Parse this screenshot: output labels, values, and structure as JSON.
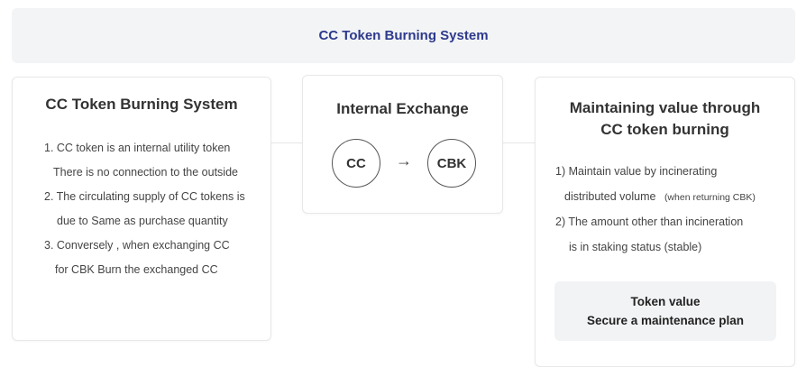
{
  "banner": {
    "title": "CC Token Burning System"
  },
  "left_card": {
    "title": "CC Token Burning System",
    "lines": [
      "1. CC token is an internal utility token",
      "There is no connection to the outside",
      "2. The circulating supply of CC tokens is",
      "due to Same as purchase quantity",
      "3. Conversely , when exchanging CC",
      "for CBK Burn the exchanged CC"
    ]
  },
  "mid_card": {
    "title": "Internal Exchange",
    "from": "CC",
    "arrow": "→",
    "to": "CBK"
  },
  "right_card": {
    "title_line1": "Maintaining value through",
    "title_line2": "CC token burning",
    "line1": "1) Maintain value by incinerating",
    "line2_main": "distributed volume",
    "line2_note": "(when returning CBK)",
    "line3": "2) The amount other than incineration",
    "line4": "is in staking status (stable)",
    "box_line1": "Token value",
    "box_line2": "Secure a maintenance plan"
  }
}
